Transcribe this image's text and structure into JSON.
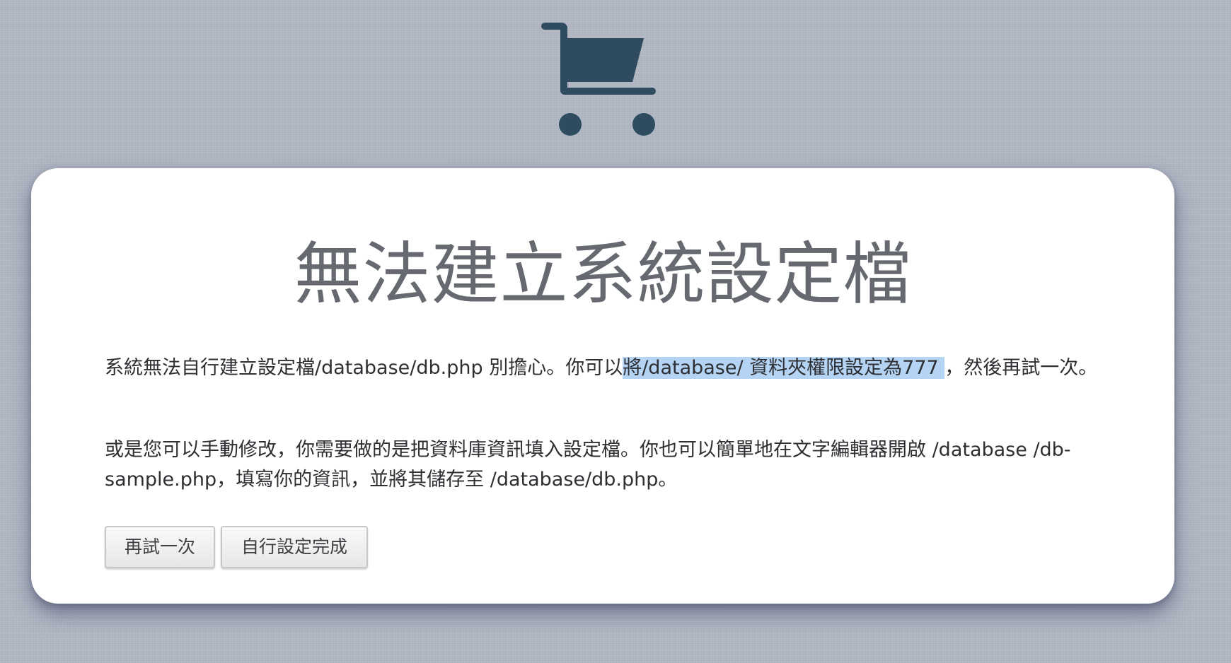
{
  "icon": {
    "name": "shopping-cart-icon",
    "color": "#2f4b5f"
  },
  "page": {
    "title": "無法建立系統設定檔"
  },
  "message": {
    "p1_before": "系統無法自行建立設定檔/database/db.php 別擔心。你可以",
    "p1_highlight": "將/database/ 資料夾權限設定為777 ",
    "p1_after": "，然後再試一次。",
    "p2": "或是您可以手動修改，你需要做的是把資料庫資訊填入設定檔。你也可以簡單地在文字編輯器開啟 /database /db-sample.php，填寫你的資訊，並將其儲存至 /database/db.php。"
  },
  "buttons": {
    "retry": "再試一次",
    "manual_done": "自行設定完成"
  },
  "colors": {
    "background": "#b1b7c3",
    "card": "#ffffff",
    "selection_highlight": "#b5d3f3"
  }
}
